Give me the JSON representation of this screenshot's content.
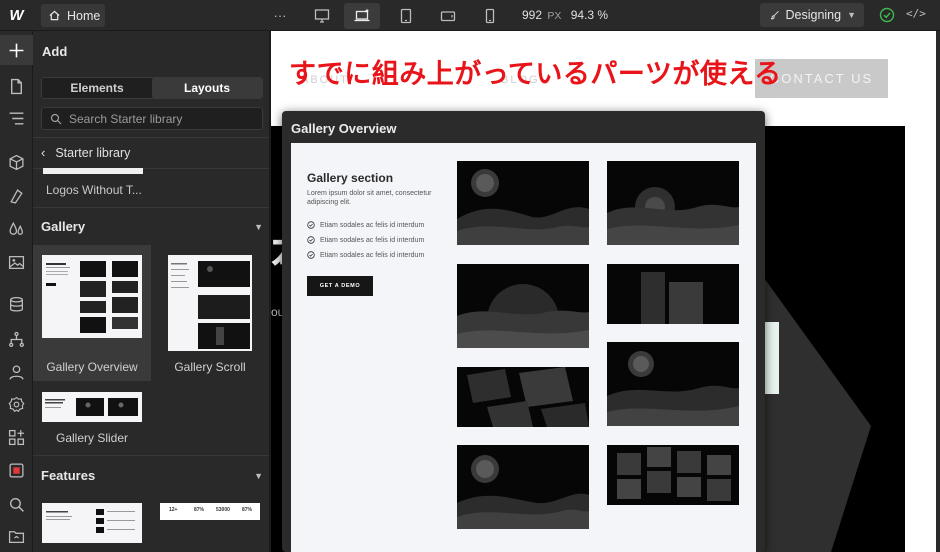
{
  "topbar": {
    "logo": "W",
    "home_label": "Home",
    "more_label": "···",
    "canvas_width": "992",
    "canvas_unit": "PX",
    "zoom": "94.3 %",
    "mode_label": "Designing",
    "code_label": "</>"
  },
  "panel": {
    "title": "Add",
    "tabs": [
      "Elements",
      "Layouts"
    ],
    "active_tab": "Layouts",
    "search_placeholder": "Search Starter library",
    "breadcrumb": "Starter library",
    "partial_item": "Logos Without T...",
    "sections": [
      {
        "title": "Gallery",
        "items": [
          "Gallery Overview",
          "Gallery Scroll",
          "Gallery Slider"
        ]
      },
      {
        "title": "Features",
        "items": []
      }
    ],
    "feature_stats": [
      "12+",
      "87%",
      "53000",
      "87%"
    ],
    "gallery_slider_heading": "Slideshow gallery section with your title"
  },
  "canvas": {
    "annotation": "すでに組み上がっているパーツが使える",
    "annotation_color": "#e8141a",
    "page_button": "CONTACT US",
    "page_nav": [
      "ABOUT",
      "BLOG"
    ],
    "hero_char": "本",
    "hero_small": "ou"
  },
  "preview": {
    "title": "Gallery Overview",
    "section_title": "Gallery section",
    "description": "Lorem ipsum dolor sit amet, consectetur adipiscing elit.",
    "bullets": [
      "Etiam sodales ac felis id interdum",
      "Etiam sodales ac felis id interdum",
      "Etiam sodales ac felis id interdum"
    ],
    "cta": "GET A DEMO"
  },
  "colors": {
    "ui_bg": "#292929",
    "accent_ok": "#3fb950",
    "annotation": "#e8141a"
  },
  "icons": [
    "home-icon",
    "desktop-icon",
    "laptop-icon",
    "tablet-icon",
    "tablet-landscape-icon",
    "phone-icon",
    "brush-icon",
    "check-circle-icon",
    "code-icon",
    "plus-icon",
    "page-icon",
    "navigator-icon",
    "cube-icon",
    "style-icon",
    "drops-icon",
    "image-icon",
    "database-icon",
    "logic-icon",
    "users-icon",
    "settings-icon",
    "apps-icon",
    "stop-icon",
    "search-icon",
    "folder-icon",
    "chevron-left-icon",
    "chevron-down-icon"
  ]
}
